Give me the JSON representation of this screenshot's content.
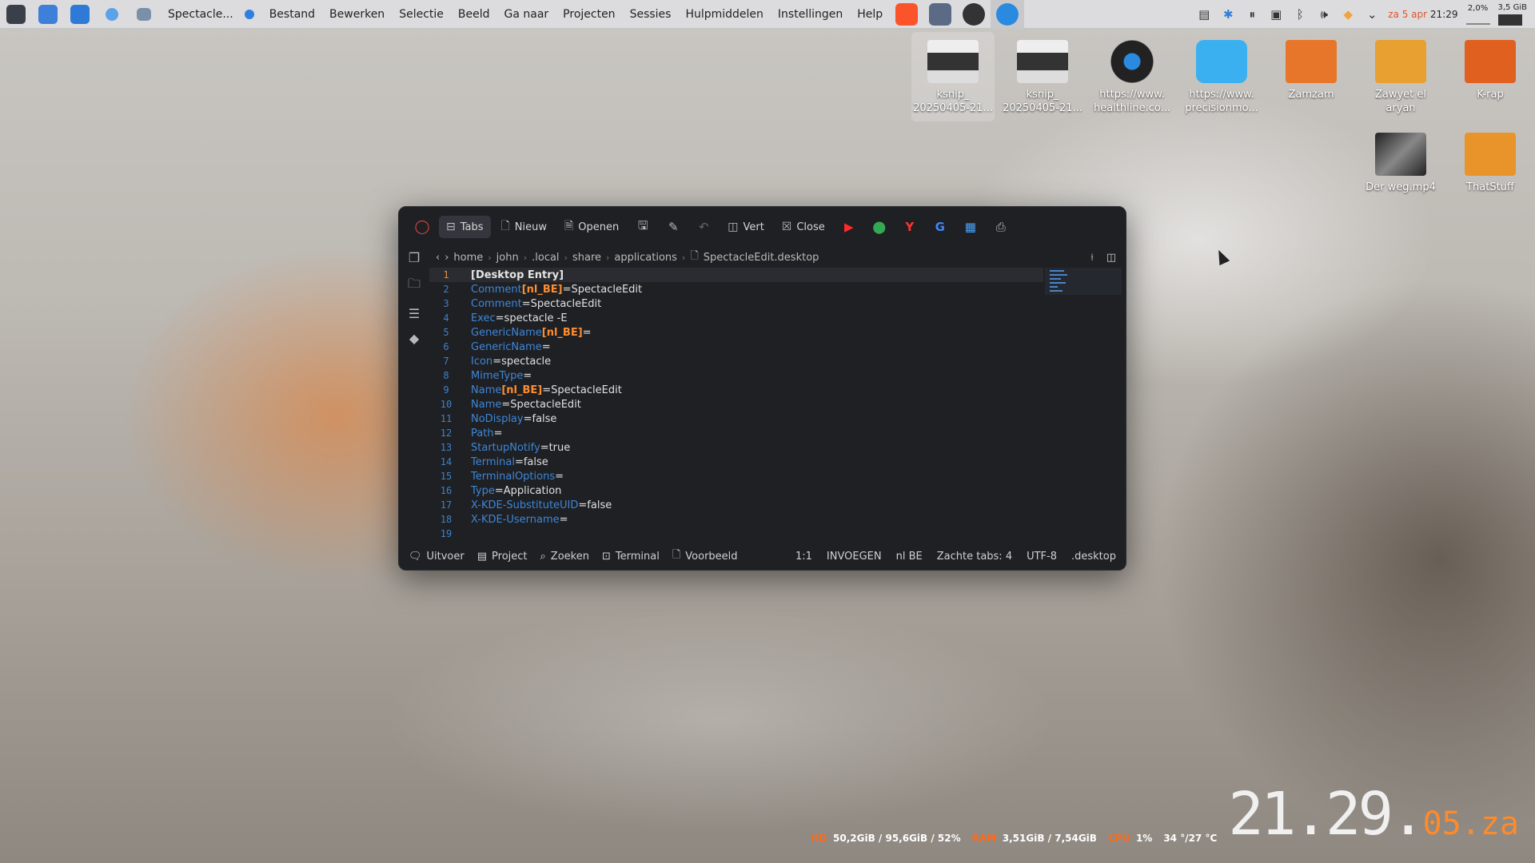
{
  "panel": {
    "app_name": "Spectacle...",
    "menu": [
      "Bestand",
      "Bewerken",
      "Selectie",
      "Beeld",
      "Ga naar",
      "Projecten",
      "Sessies",
      "Hulpmiddelen",
      "Instellingen",
      "Help"
    ],
    "clock": "za 5 apr 21:29",
    "clock_day": "za",
    "clock_date": "5 apr",
    "clock_time": "21:29",
    "cpu_mini": "2,0%",
    "mem_mini": "3,5 GiB"
  },
  "desktop_icons": [
    {
      "label": "ksnip_ 20250405-21..."
    },
    {
      "label": "ksnip_ 20250405-21..."
    },
    {
      "label": "https://www. healthline.co..."
    },
    {
      "label": "https://www. precisionmo..."
    },
    {
      "label": "Zamzam"
    },
    {
      "label": "Zawyet el aryan"
    },
    {
      "label": "K-rap"
    },
    {
      "label": "Der weg.mp4"
    },
    {
      "label": "ThatStuff"
    }
  ],
  "editor": {
    "toolbar": {
      "tabs": "Tabs",
      "new": "Nieuw",
      "open": "Openen",
      "vert": "Vert",
      "close": "Close"
    },
    "breadcrumb": [
      "home",
      "john",
      ".local",
      "share",
      "applications",
      "SpectacleEdit.desktop"
    ],
    "lines": [
      {
        "n": "1",
        "key": "",
        "bracket": "",
        "val": "[Desktop Entry]"
      },
      {
        "n": "2",
        "key": "Comment",
        "bracket": "[nl_BE]",
        "val": "=SpectacleEdit"
      },
      {
        "n": "3",
        "key": "Comment",
        "bracket": "",
        "val": "=SpectacleEdit"
      },
      {
        "n": "4",
        "key": "Exec",
        "bracket": "",
        "val": "=spectacle -E"
      },
      {
        "n": "5",
        "key": "GenericName",
        "bracket": "[nl_BE]",
        "val": "="
      },
      {
        "n": "6",
        "key": "GenericName",
        "bracket": "",
        "val": "="
      },
      {
        "n": "7",
        "key": "Icon",
        "bracket": "",
        "val": "=spectacle"
      },
      {
        "n": "8",
        "key": "MimeType",
        "bracket": "",
        "val": "="
      },
      {
        "n": "9",
        "key": "Name",
        "bracket": "[nl_BE]",
        "val": "=SpectacleEdit"
      },
      {
        "n": "10",
        "key": "Name",
        "bracket": "",
        "val": "=SpectacleEdit"
      },
      {
        "n": "11",
        "key": "NoDisplay",
        "bracket": "",
        "val": "=false"
      },
      {
        "n": "12",
        "key": "Path",
        "bracket": "",
        "val": "="
      },
      {
        "n": "13",
        "key": "StartupNotify",
        "bracket": "",
        "val": "=true"
      },
      {
        "n": "14",
        "key": "Terminal",
        "bracket": "",
        "val": "=false"
      },
      {
        "n": "15",
        "key": "TerminalOptions",
        "bracket": "",
        "val": "="
      },
      {
        "n": "16",
        "key": "Type",
        "bracket": "",
        "val": "=Application"
      },
      {
        "n": "17",
        "key": "X-KDE-SubstituteUID",
        "bracket": "",
        "val": "=false"
      },
      {
        "n": "18",
        "key": "X-KDE-Username",
        "bracket": "",
        "val": "="
      },
      {
        "n": "19",
        "key": "",
        "bracket": "",
        "val": ""
      }
    ],
    "statusbar": {
      "output": "Uitvoer",
      "project": "Project",
      "search": "Zoeken",
      "terminal": "Terminal",
      "preview": "Voorbeeld",
      "cursor": "1:1",
      "mode": "INVOEGEN",
      "lang": "nl BE",
      "tabs": "Zachte tabs: 4",
      "encoding": "UTF-8",
      "filetype": ".desktop"
    }
  },
  "conky": {
    "hd_label": "HD",
    "hd_value": "50,2GiB / 95,6GiB / 52%",
    "ram_label": "RAM",
    "ram_value": "3,51GiB / 7,54GiB",
    "cpu_label": "CPU",
    "cpu_value": "1%",
    "temp_value": "34 °/27 °C",
    "clock_main": "21.29.",
    "clock_small": "05.za"
  },
  "colors": {
    "accent": "#3e86d6",
    "highlight": "#ff8c2e",
    "editor_bg": "#1e2024"
  }
}
